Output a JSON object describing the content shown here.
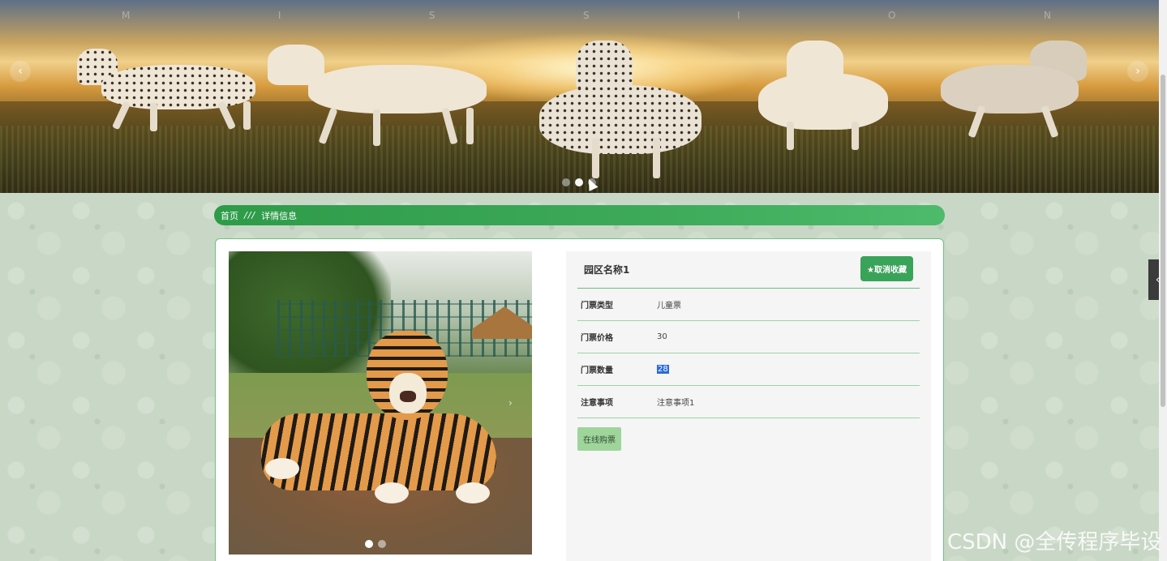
{
  "banner": {
    "letters": [
      "M",
      "I",
      "S",
      "S",
      "I",
      "O",
      "N"
    ],
    "prev_icon": "‹",
    "next_icon": "›",
    "slide_count": 3,
    "active_slide": 2
  },
  "breadcrumb": {
    "home": "首页",
    "separator": "///",
    "current": "详情信息"
  },
  "detail": {
    "title": "园区名称1",
    "favorite_button": "★取消收藏",
    "rows": [
      {
        "label": "门票类型",
        "value": "儿童票"
      },
      {
        "label": "门票价格",
        "value": "30"
      },
      {
        "label": "门票数量",
        "value": "28"
      },
      {
        "label": "注意事项",
        "value": "注意事项1"
      }
    ],
    "buy_button": "在线购票"
  },
  "photo": {
    "slide_count": 2,
    "active_slide": 1
  },
  "side_tab": {
    "icon": "‹"
  },
  "watermark": "CSDN @全传程序毕设",
  "colors": {
    "accent": "#3aa35a",
    "breadcrumb": "#2e9b49",
    "buy_button": "#9fd49b",
    "selection": "#2a6ad7"
  }
}
